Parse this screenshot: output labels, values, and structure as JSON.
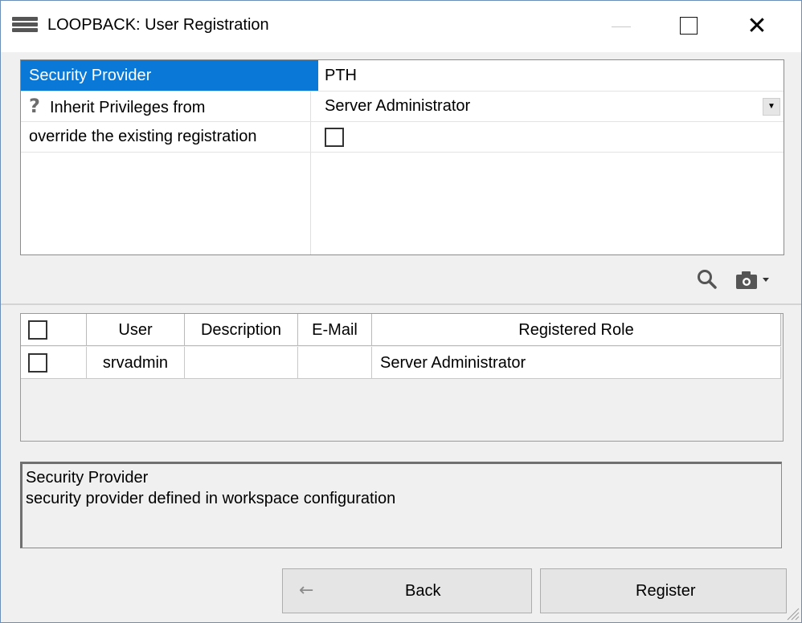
{
  "window": {
    "title": "LOOPBACK: User Registration",
    "controls": {
      "minimize": "—",
      "maximize": "☐",
      "close": "✕"
    }
  },
  "properties": [
    {
      "label": "Security Provider",
      "value": "PTH",
      "selected": true
    },
    {
      "label": "Inherit Privileges from",
      "value": "Server Administrator",
      "icon": "question-icon",
      "type": "dropdown"
    },
    {
      "label": "override the existing registration",
      "type": "checkbox",
      "checked": false
    }
  ],
  "toolbar": {
    "icons": [
      "search-icon",
      "camera-icon",
      "chevron-down-icon"
    ]
  },
  "table": {
    "columns": [
      "User",
      "Description",
      "E-Mail",
      "Registered Role"
    ],
    "rows": [
      {
        "checked": false,
        "user": "srvadmin",
        "description": "",
        "email": "",
        "role": "Server Administrator"
      }
    ]
  },
  "description": {
    "title": "Security Provider",
    "text": "security provider defined in workspace configuration"
  },
  "buttons": {
    "back_arrow": "←",
    "back": "Back",
    "register": "Register"
  },
  "colors": {
    "selection": "#0a78d7",
    "window_bg": "#f0f0f0"
  }
}
